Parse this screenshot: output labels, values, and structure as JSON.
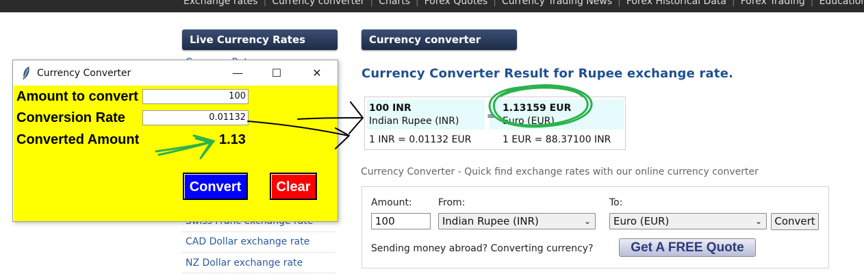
{
  "topnav": {
    "items": [
      "Exchange rates",
      "Currency converter",
      "Charts",
      "Forex Quotes",
      "Currency Trading News",
      "Forex Historical Data",
      "Forex Trading",
      "Education"
    ]
  },
  "sidebar": {
    "header": "Live Currency Rates",
    "hidden_item": "Currency Rates",
    "links": [
      "Swiss Franc exchange rate",
      "CAD Dollar exchange rate",
      "NZ Dollar exchange rate"
    ]
  },
  "main": {
    "header": "Currency converter",
    "result_title": "Currency Converter Result for Rupee exchange rate.",
    "result": {
      "from_amount": "100 INR",
      "from_name": "Indian Rupee (INR)",
      "equals": "=",
      "to_amount": "1.13159 EUR",
      "to_name": "Euro (EUR)",
      "rate_forward": "1 INR = 0.01132 EUR",
      "rate_reverse": "1 EUR = 88.37100 INR"
    },
    "quick_find": "Currency Converter - Quick find exchange rates with our online currency converter",
    "form": {
      "amount_label": "Amount:",
      "amount_value": "100",
      "from_label": "From:",
      "from_value": "Indian Rupee (INR)",
      "to_label": "To:",
      "to_value": "Euro (EUR)",
      "convert_label": "Convert",
      "sending_text": "Sending money abroad? Converting currency?",
      "quote_button": "Get A FREE Quote"
    }
  },
  "tk_window": {
    "title": "Currency Converter",
    "controls": {
      "minimize": "—",
      "maximize": "☐",
      "close": "✕"
    },
    "amount_label": "Amount to convert",
    "amount_value": "100",
    "rate_label": "Conversion Rate",
    "rate_value": "0.01132",
    "converted_label": "Converted Amount",
    "converted_value": "1.13",
    "convert_button": "Convert",
    "clear_button": "Clear",
    "colors": {
      "background": "#ffff00",
      "convert_bg": "#0000ff",
      "clear_bg": "#ff0000"
    }
  },
  "annotations": {
    "arrow_color": "#000000",
    "highlight_color": "#2bb24c"
  }
}
